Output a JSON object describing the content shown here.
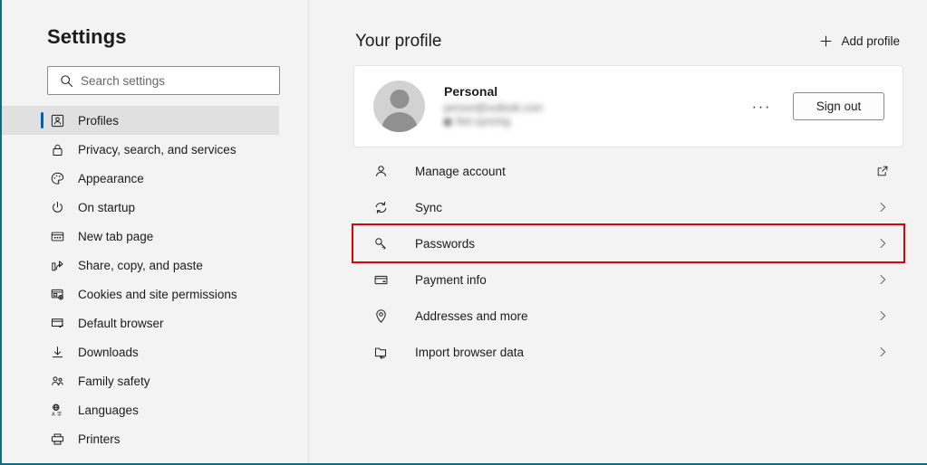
{
  "window": {
    "accent_border_color": "#16697a",
    "background_color": "#f3f3f3"
  },
  "sidebar": {
    "title": "Settings",
    "search": {
      "placeholder": "Search settings",
      "value": "",
      "icon": "search-icon"
    },
    "selected_index": 0,
    "selected_accent_color": "#005fb8",
    "items": [
      {
        "label": "Profiles",
        "icon": "profile-card-icon",
        "selected": true
      },
      {
        "label": "Privacy, search, and services",
        "icon": "lock-icon",
        "selected": false
      },
      {
        "label": "Appearance",
        "icon": "palette-icon",
        "selected": false
      },
      {
        "label": "On startup",
        "icon": "power-icon",
        "selected": false
      },
      {
        "label": "New tab page",
        "icon": "new-tab-page-icon",
        "selected": false
      },
      {
        "label": "Share, copy, and paste",
        "icon": "share-icon",
        "selected": false
      },
      {
        "label": "Cookies and site permissions",
        "icon": "cookies-permissions-icon",
        "selected": false
      },
      {
        "label": "Default browser",
        "icon": "default-browser-icon",
        "selected": false
      },
      {
        "label": "Downloads",
        "icon": "download-arrow-icon",
        "selected": false
      },
      {
        "label": "Family safety",
        "icon": "family-people-icon",
        "selected": false
      },
      {
        "label": "Languages",
        "icon": "languages-icon",
        "selected": false
      },
      {
        "label": "Printers",
        "icon": "printer-icon",
        "selected": false
      }
    ],
    "scrollbar": {
      "visible": true
    }
  },
  "main": {
    "page_title": "Your profile",
    "add_profile": {
      "label": "Add profile",
      "icon": "plus-icon"
    },
    "profile_card": {
      "name": "Personal",
      "email_redacted": "person@outlook.com",
      "sync_status_redacted": "Not syncing",
      "avatar_icon": "avatar-person-icon",
      "more_options_label": "···",
      "sign_out_label": "Sign out"
    },
    "rows": [
      {
        "label": "Manage account",
        "icon": "person-icon",
        "end_icon": "external-link-icon",
        "highlighted": false
      },
      {
        "label": "Sync",
        "icon": "sync-refresh-icon",
        "end_icon": "chevron-right-icon",
        "highlighted": false
      },
      {
        "label": "Passwords",
        "icon": "key-icon",
        "end_icon": "chevron-right-icon",
        "highlighted": true
      },
      {
        "label": "Payment info",
        "icon": "credit-card-icon",
        "end_icon": "chevron-right-icon",
        "highlighted": false
      },
      {
        "label": "Addresses and more",
        "icon": "location-pin-icon",
        "end_icon": "chevron-right-icon",
        "highlighted": false
      },
      {
        "label": "Import browser data",
        "icon": "import-folder-icon",
        "end_icon": "chevron-right-icon",
        "highlighted": false
      }
    ],
    "highlight_color": "#e00000"
  }
}
